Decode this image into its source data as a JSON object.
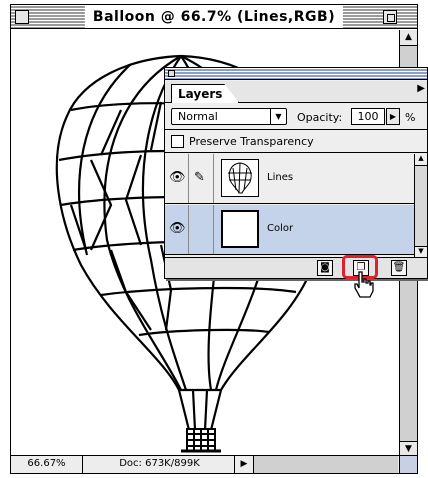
{
  "document": {
    "title": "Balloon @ 66.7% (Lines,RGB)",
    "status": {
      "zoom": "66.67%",
      "doc_info": "Doc: 673K/899K"
    }
  },
  "layers_palette": {
    "tab_label": "Layers",
    "blend_mode": "Normal",
    "opacity_label": "Opacity:",
    "opacity_value": "100",
    "opacity_unit": "%",
    "preserve_label": "Preserve Transparency",
    "layers": [
      {
        "name": "Lines",
        "visible": true,
        "selected": false
      },
      {
        "name": "Color",
        "visible": true,
        "selected": true
      }
    ],
    "highlight_color": "#e0202a",
    "selection_color": "#c5d3ea"
  },
  "icons": [
    "eye-icon",
    "brush-icon",
    "layer-mask-icon",
    "new-layer-icon",
    "trash-icon",
    "hand-pointer-cursor-icon"
  ]
}
